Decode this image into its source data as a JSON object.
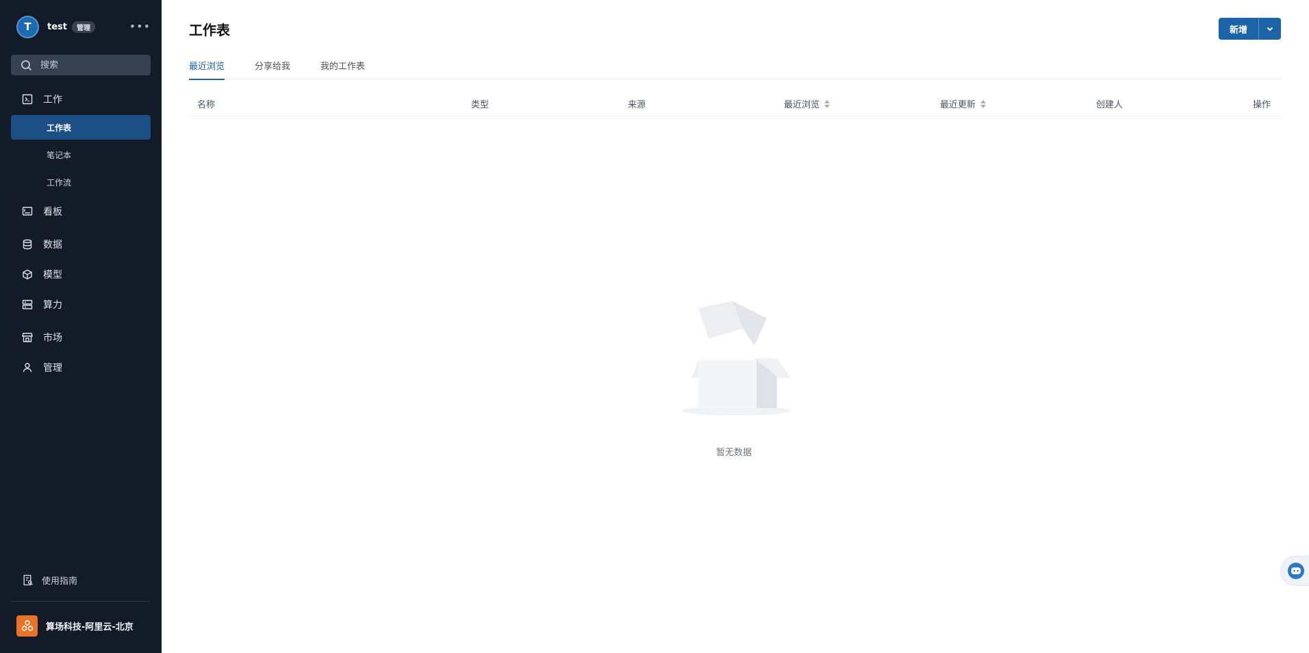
{
  "user": {
    "initial": "T",
    "name": "test",
    "role": "管理"
  },
  "search": {
    "placeholder": "搜索"
  },
  "nav": {
    "work": "工作",
    "work_sub": [
      "工作表",
      "笔记本",
      "工作流"
    ],
    "dashboard": "看板",
    "data": "数据",
    "model": "模型",
    "compute": "算力",
    "market": "市场",
    "admin": "管理"
  },
  "guide": "使用指南",
  "org": "算场科技-阿里云-北京",
  "page": {
    "title": "工作表",
    "new_label": "新增"
  },
  "tabs": [
    "最近浏览",
    "分享给我",
    "我的工作表"
  ],
  "table": {
    "columns": [
      "名称",
      "类型",
      "来源",
      "最近浏览",
      "最近更新",
      "创建人",
      "操作"
    ],
    "empty_text": "暂无数据"
  },
  "colors": {
    "sidebar_bg": "#131a28",
    "accent": "#1c64a8",
    "active_item": "#1b4f86",
    "org_logo": "#e8742a"
  }
}
